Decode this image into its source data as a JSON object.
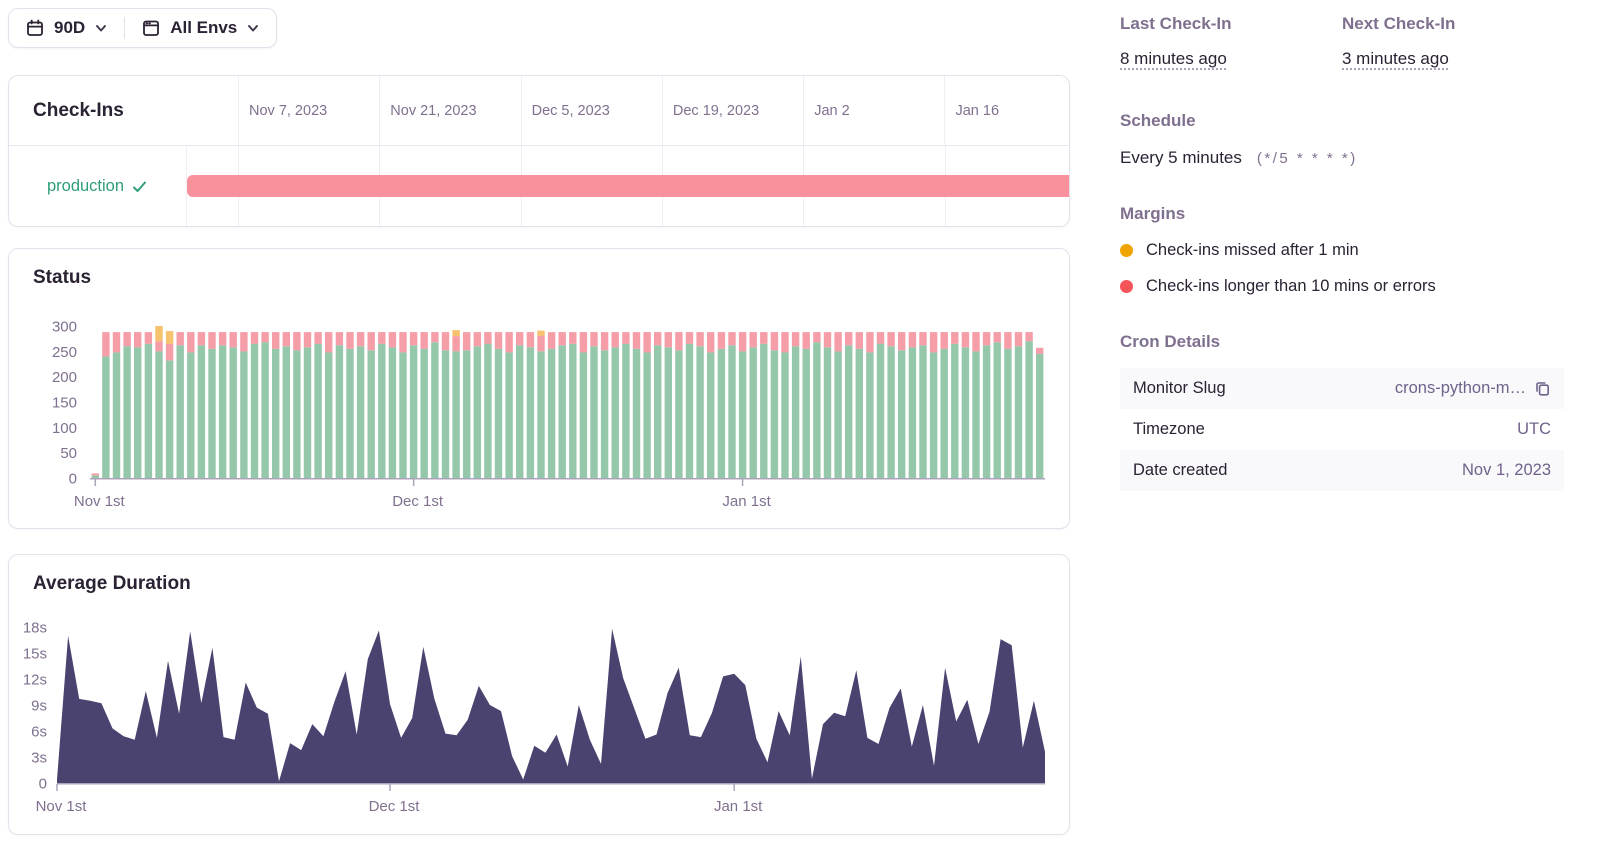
{
  "filters": {
    "date_range": {
      "label": "90D"
    },
    "environment": {
      "label": "All Envs"
    }
  },
  "sidebar": {
    "last_checkin": {
      "label": "Last Check-In",
      "value": "8 minutes ago"
    },
    "next_checkin": {
      "label": "Next Check-In",
      "value": "3 minutes ago"
    },
    "schedule": {
      "label": "Schedule",
      "value": "Every 5 minutes",
      "cron": "(*/5 * * * *)"
    },
    "margins": {
      "label": "Margins",
      "items": [
        {
          "color": "#f0a400",
          "text": "Check-ins missed after 1 min"
        },
        {
          "color": "#f55459",
          "text": "Check-ins longer than 10 mins or errors"
        }
      ]
    },
    "cron_details": {
      "label": "Cron Details",
      "rows": [
        {
          "label": "Monitor Slug",
          "value": "crons-python-m…",
          "has_copy_icon": true
        },
        {
          "label": "Timezone",
          "value": "UTC"
        },
        {
          "label": "Date created",
          "value": "Nov 1, 2023"
        }
      ]
    }
  },
  "chart_data": [
    {
      "type": "timeline",
      "title": "Check-Ins",
      "x_ticks": [
        "Nov 7, 2023",
        "Nov 21, 2023",
        "Dec 5, 2023",
        "Dec 19, 2023",
        "Jan 2",
        "Jan 16"
      ],
      "rows": [
        {
          "label": "production",
          "status": "ok",
          "bar": {
            "color": "#f8919b",
            "start_frac": 0,
            "end_frac": 1
          }
        }
      ]
    },
    {
      "type": "bar",
      "stacked": true,
      "title": "Status",
      "ylim": [
        0,
        300
      ],
      "ytick_values": [
        0,
        50,
        100,
        150,
        200,
        250,
        300
      ],
      "ytick_labels": [
        "0",
        "50",
        "100",
        "150",
        "200",
        "250",
        "300"
      ],
      "x_ticks": [
        {
          "label": "Nov 1st",
          "day": 0
        },
        {
          "label": "Dec 1st",
          "day": 30
        },
        {
          "label": "Jan 1st",
          "day": 61
        }
      ],
      "series": [
        {
          "name": "ok",
          "color": "#95c7aa",
          "values": [
            5,
            240,
            248,
            260,
            258,
            265,
            250,
            232,
            262,
            248,
            262,
            255,
            262,
            258,
            250,
            265,
            268,
            255,
            260,
            252,
            258,
            265,
            248,
            262,
            255,
            260,
            252,
            265,
            258,
            248,
            262,
            255,
            268,
            252,
            250,
            252,
            260,
            265,
            255,
            248,
            262,
            258,
            250,
            255,
            262,
            265,
            248,
            260,
            252,
            258,
            265,
            255,
            248,
            262,
            258,
            252,
            265,
            260,
            248,
            255,
            262,
            250,
            258,
            265,
            252,
            248,
            260,
            255,
            268,
            258,
            250,
            262,
            255,
            248,
            265,
            260,
            252,
            258,
            262,
            248,
            255,
            265,
            258,
            250,
            262,
            268,
            255,
            260,
            270,
            245
          ]
        },
        {
          "name": "timeout_or_error",
          "color": "#f59ea7",
          "values": [
            4,
            48,
            40,
            28,
            30,
            23,
            20,
            33,
            26,
            40,
            26,
            33,
            26,
            30,
            38,
            23,
            20,
            33,
            28,
            36,
            30,
            23,
            40,
            26,
            33,
            28,
            36,
            23,
            30,
            40,
            26,
            33,
            20,
            36,
            30,
            36,
            28,
            23,
            33,
            40,
            26,
            30,
            31,
            33,
            26,
            23,
            40,
            28,
            36,
            30,
            23,
            33,
            40,
            26,
            30,
            36,
            23,
            28,
            40,
            33,
            26,
            38,
            30,
            23,
            36,
            40,
            28,
            33,
            20,
            30,
            38,
            26,
            33,
            40,
            23,
            28,
            36,
            30,
            26,
            40,
            33,
            23,
            30,
            38,
            26,
            20,
            33,
            28,
            18,
            12
          ]
        },
        {
          "name": "missed",
          "color": "#f6c26d",
          "values": [
            0,
            0,
            0,
            0,
            0,
            0,
            30,
            25,
            0,
            0,
            0,
            0,
            0,
            0,
            0,
            0,
            0,
            0,
            0,
            0,
            0,
            0,
            0,
            0,
            0,
            0,
            0,
            0,
            0,
            0,
            0,
            0,
            0,
            0,
            12,
            0,
            0,
            0,
            0,
            0,
            0,
            0,
            10,
            0,
            0,
            0,
            0,
            0,
            0,
            0,
            0,
            0,
            0,
            0,
            0,
            0,
            0,
            0,
            0,
            0,
            0,
            0,
            0,
            0,
            0,
            0,
            0,
            0,
            0,
            0,
            0,
            0,
            0,
            0,
            0,
            0,
            0,
            0,
            0,
            0,
            0,
            0,
            0,
            0,
            0,
            0,
            0,
            0,
            0,
            0
          ]
        }
      ]
    },
    {
      "type": "area",
      "title": "Average Duration",
      "ylim": [
        0,
        18
      ],
      "ytick_values": [
        0,
        3,
        6,
        9,
        12,
        15,
        18
      ],
      "ytick_labels": [
        "0",
        "3s",
        "6s",
        "9s",
        "12s",
        "15s",
        "18s"
      ],
      "x_ticks": [
        {
          "label": "Nov 1st",
          "day": 0
        },
        {
          "label": "Dec 1st",
          "day": 30
        },
        {
          "label": "Jan 1st",
          "day": 61
        }
      ],
      "series": [
        {
          "name": "avg_duration_seconds",
          "color": "#4a4370",
          "values": [
            0.4,
            17,
            9.7,
            9.5,
            9.2,
            6.3,
            5.4,
            5,
            10.6,
            5.2,
            14.1,
            8,
            17.5,
            9.2,
            15.6,
            5.3,
            5,
            11.6,
            8.7,
            8,
            0.2,
            4.6,
            3.8,
            6.8,
            5.4,
            9.4,
            12.9,
            5.6,
            14.3,
            17.6,
            9.1,
            5.2,
            7.5,
            15.7,
            9.7,
            5.7,
            5.5,
            7.3,
            11.2,
            9,
            8.3,
            3.1,
            0.4,
            4.3,
            3.5,
            5.6,
            1.9,
            9,
            5,
            2.2,
            17.8,
            12.1,
            8.6,
            5.1,
            5.6,
            10.4,
            13.3,
            5.5,
            5.3,
            8.1,
            12.3,
            12.6,
            11.3,
            5.1,
            2.4,
            8.3,
            5.5,
            14.6,
            0.5,
            6.8,
            8.1,
            7.7,
            13,
            5.2,
            4.5,
            8.7,
            10.9,
            4.2,
            9,
            2,
            13.3,
            7.1,
            9.6,
            4.5,
            8.2,
            16.6,
            15.9,
            4.1,
            9.5,
            3.6
          ]
        }
      ]
    }
  ]
}
